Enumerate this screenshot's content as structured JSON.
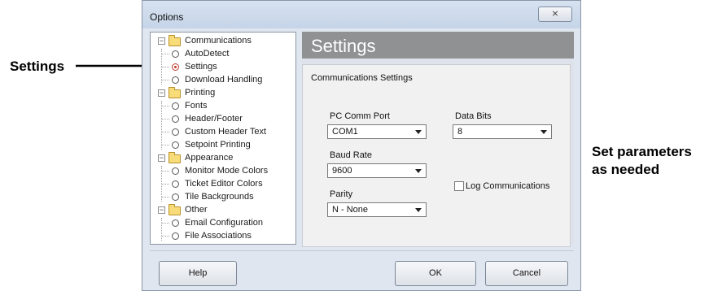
{
  "window": {
    "title": "Options",
    "close_glyph": "⨯"
  },
  "tree": {
    "groups": [
      {
        "label": "Communications",
        "children": [
          "AutoDetect",
          "Settings",
          "Download Handling"
        ]
      },
      {
        "label": "Printing",
        "children": [
          "Fonts",
          "Header/Footer",
          "Custom Header Text",
          "Setpoint Printing"
        ]
      },
      {
        "label": "Appearance",
        "children": [
          "Monitor Mode Colors",
          "Ticket Editor Colors",
          "Tile Backgrounds"
        ]
      },
      {
        "label": "Other",
        "children": [
          "Email Configuration",
          "File Associations"
        ]
      }
    ],
    "selected": "Settings"
  },
  "panel": {
    "title": "Settings",
    "section_label": "Communications Settings",
    "fields": {
      "pc_comm_port": {
        "label": "PC Comm Port",
        "value": "COM1"
      },
      "data_bits": {
        "label": "Data Bits",
        "value": "8"
      },
      "baud_rate": {
        "label": "Baud Rate",
        "value": "9600"
      },
      "parity": {
        "label": "Parity",
        "value": "N - None"
      }
    },
    "log_communications": {
      "label": "Log Communications",
      "checked": false
    }
  },
  "buttons": {
    "help": "Help",
    "ok": "OK",
    "cancel": "Cancel"
  },
  "annotations": {
    "left": "Settings",
    "right_line1": "Set parameters",
    "right_line2": "as needed"
  }
}
